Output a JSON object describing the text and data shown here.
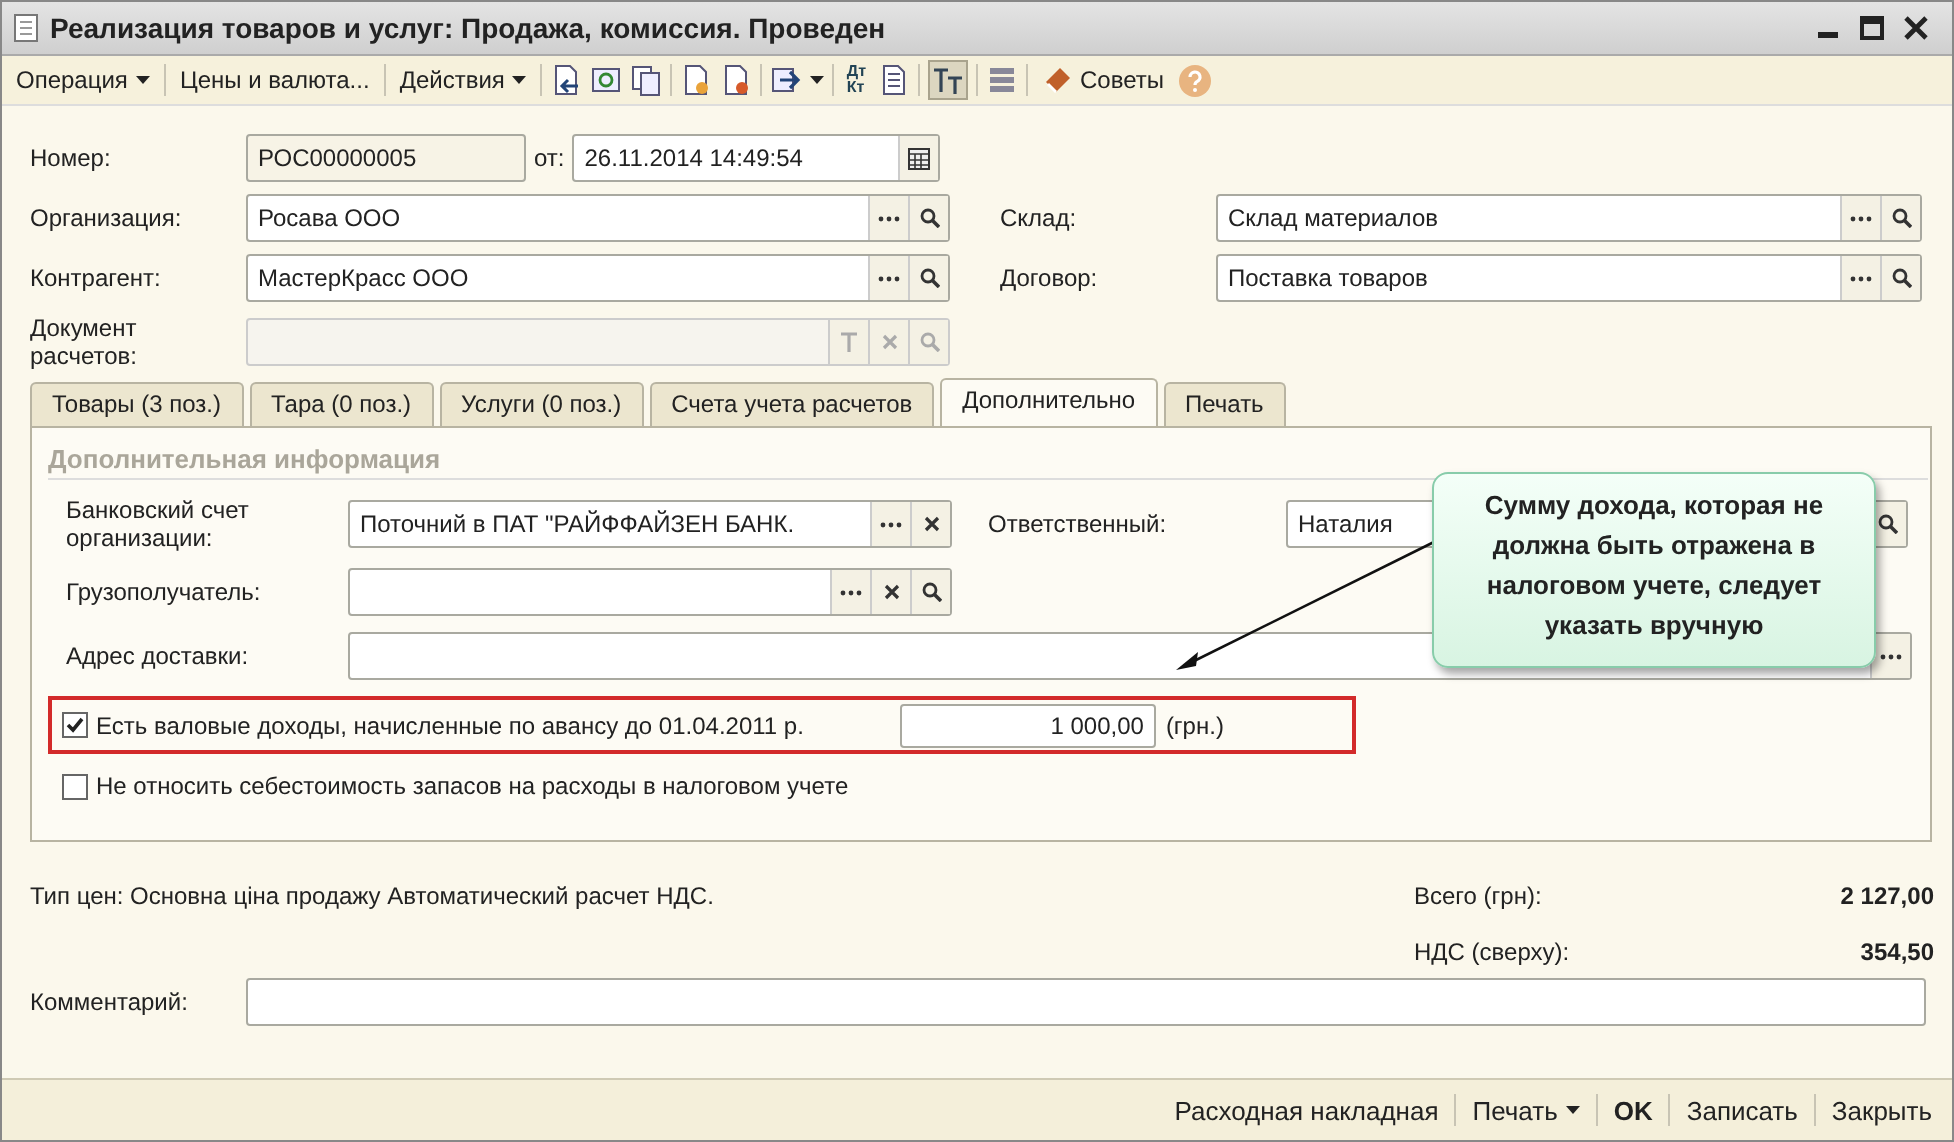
{
  "window": {
    "title": "Реализация товаров и услуг: Продажа, комиссия. Проведен"
  },
  "toolbar": {
    "menus": [
      {
        "label": "Операция",
        "dropdown": true
      },
      {
        "label": "Цены и валюта...",
        "dropdown": false
      },
      {
        "label": "Действия",
        "dropdown": true
      }
    ],
    "dt_label": "Дт",
    "kt_label": "Кт",
    "toggle_selected": true,
    "tips_label": "Советы"
  },
  "header": {
    "number_label": "Номер:",
    "number_value": "РОС00000005",
    "date_label": "от:",
    "date_value": "26.11.2014 14:49:54",
    "fields": [
      {
        "label": "Организация:",
        "value": "Росава ООО",
        "buttons": [
          {
            "kind": "select"
          },
          {
            "kind": "search"
          }
        ],
        "disabled": false
      },
      {
        "label": "Склад:",
        "value": "Склад материалов",
        "buttons": [
          {
            "kind": "select"
          },
          {
            "kind": "search"
          }
        ],
        "disabled": false
      },
      {
        "label": "Контрагент:",
        "value": "МастерКрасс ООО",
        "buttons": [
          {
            "kind": "select"
          },
          {
            "kind": "search"
          }
        ],
        "disabled": false
      },
      {
        "label": "Договор:",
        "value": "Поставка товаров",
        "buttons": [
          {
            "kind": "select"
          },
          {
            "kind": "search"
          }
        ],
        "disabled": false
      },
      {
        "label": "Документ расчетов:",
        "buttons": [
          {
            "kind": "type"
          },
          {
            "kind": "clear"
          },
          {
            "kind": "search"
          }
        ],
        "disabled": true
      }
    ]
  },
  "tabs": [
    {
      "label": "Товары (3 поз.)",
      "selected": false
    },
    {
      "label": "Тара (0 поз.)",
      "selected": false
    },
    {
      "label": "Услуги (0 поз.)",
      "selected": false
    },
    {
      "label": "Счета учета расчетов",
      "selected": false
    },
    {
      "label": "Дополнительно",
      "selected": true
    },
    {
      "label": "Печать",
      "selected": false
    }
  ],
  "panel": {
    "group_title": "Дополнительная информация",
    "fields": [
      {
        "label": "Банковский счет организации:",
        "value": "Поточний в ПАТ \"РАЙФФАЙЗЕН БАНК.",
        "buttons": [
          {
            "kind": "select"
          },
          {
            "kind": "clear"
          }
        ]
      },
      {
        "label": "Ответственный:",
        "value": "Наталия",
        "buttons": [
          {
            "kind": "search"
          }
        ]
      },
      {
        "label": "Грузополучатель:",
        "buttons": [
          {
            "kind": "select"
          },
          {
            "kind": "clear"
          },
          {
            "kind": "search"
          }
        ]
      },
      {
        "label": "Адрес доставки:",
        "buttons": [
          {
            "kind": "select"
          }
        ]
      }
    ],
    "checkboxes": [
      {
        "label": "Есть валовые доходы, начисленные по авансу до 01.04.2011 р.",
        "checked": true,
        "highlighted": true,
        "amount": "1 000,00",
        "unit": "(грн.)"
      },
      {
        "label": "Не относить себестоимость запасов на расходы в налоговом учете",
        "checked": false,
        "highlighted": false
      }
    ],
    "callout": "Сумму дохода, которая не должна быть отражена в налоговом учете, следует указать вручную"
  },
  "footer": {
    "price_type": "Тип цен: Основна ціна продажу Автоматический расчет НДС.",
    "totals": [
      {
        "label": "Всего (грн):",
        "value": "2 127,00"
      },
      {
        "label": "НДС (сверху):",
        "value": "354,50"
      }
    ],
    "comment_label": "Комментарий:"
  },
  "bottom_buttons": [
    {
      "label": "Расходная накладная",
      "dropdown": false,
      "default": false
    },
    {
      "label": "Печать",
      "dropdown": true,
      "default": false
    },
    {
      "label": "OK",
      "dropdown": false,
      "default": true
    },
    {
      "label": "Записать",
      "dropdown": false,
      "default": false
    },
    {
      "label": "Закрыть",
      "dropdown": false,
      "default": false
    }
  ]
}
